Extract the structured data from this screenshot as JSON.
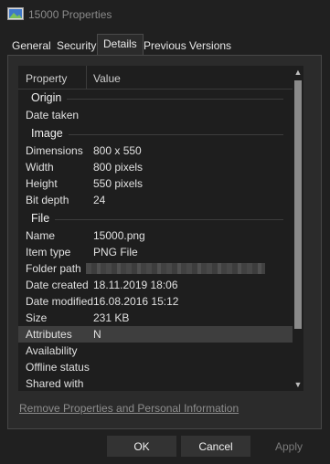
{
  "window": {
    "title": "15000 Properties"
  },
  "tabs": [
    {
      "label": "General",
      "selected": false
    },
    {
      "label": "Security",
      "selected": false
    },
    {
      "label": "Details",
      "selected": true
    },
    {
      "label": "Previous Versions",
      "selected": false
    }
  ],
  "table": {
    "headers": {
      "property": "Property",
      "value": "Value"
    },
    "groups": [
      {
        "name": "Origin",
        "rows": [
          {
            "key": "Date taken",
            "value": ""
          }
        ]
      },
      {
        "name": "Image",
        "rows": [
          {
            "key": "Dimensions",
            "value": "800 x 550"
          },
          {
            "key": "Width",
            "value": "800 pixels"
          },
          {
            "key": "Height",
            "value": "550 pixels"
          },
          {
            "key": "Bit depth",
            "value": "24"
          }
        ]
      },
      {
        "name": "File",
        "rows": [
          {
            "key": "Name",
            "value": "15000.png"
          },
          {
            "key": "Item type",
            "value": "PNG File"
          },
          {
            "key": "Folder path",
            "value": ""
          },
          {
            "key": "Date created",
            "value": "18.11.2019 18:06"
          },
          {
            "key": "Date modified",
            "value": "16.08.2016 15:12"
          },
          {
            "key": "Size",
            "value": "231 KB"
          },
          {
            "key": "Attributes",
            "value": "N"
          },
          {
            "key": "Availability",
            "value": ""
          },
          {
            "key": "Offline status",
            "value": ""
          },
          {
            "key": "Shared with",
            "value": ""
          }
        ]
      }
    ]
  },
  "link": "Remove Properties and Personal Information",
  "buttons": {
    "ok": "OK",
    "cancel": "Cancel",
    "apply": "Apply"
  },
  "colors": {
    "background": "#202020",
    "panel": "#2b2b2b",
    "list": "#1e1e1e",
    "highlight": "#3e3e3e"
  },
  "icons": {
    "title": "image-file-icon",
    "scroll_up": "chevron-up-icon",
    "scroll_down": "chevron-down-icon"
  }
}
